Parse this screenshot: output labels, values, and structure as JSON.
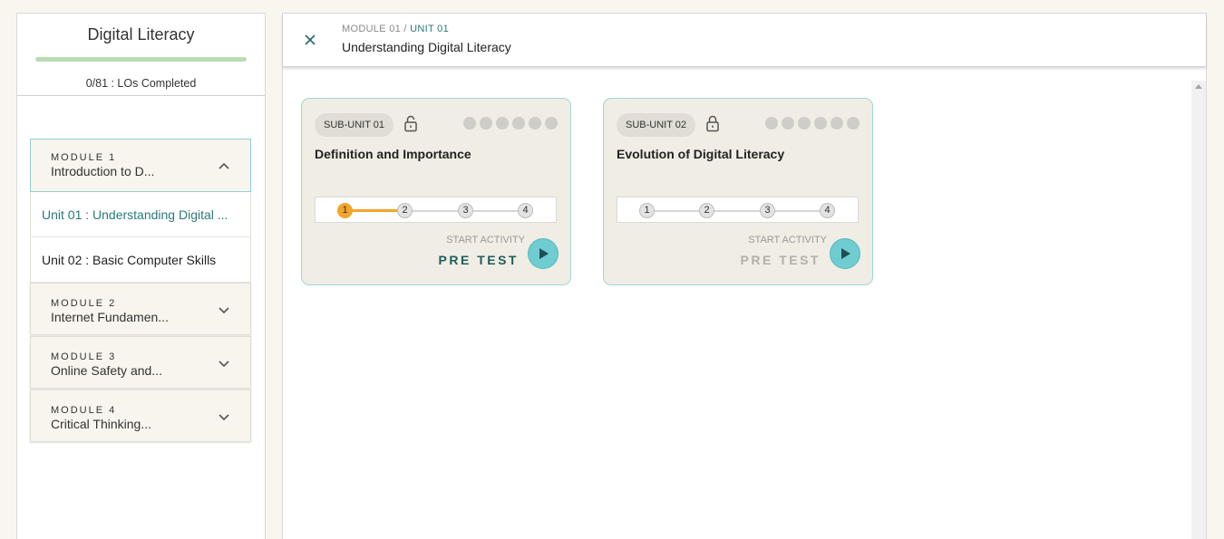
{
  "sidebar": {
    "title": "Digital Literacy",
    "progress_text": "0/81 : LOs Completed",
    "progress_fraction": 0,
    "modules": [
      {
        "number": "MODULE 1",
        "name": "Introduction to D...",
        "expanded": true,
        "units": [
          {
            "label": "Unit 01 : Understanding Digital ...",
            "active": true
          },
          {
            "label": "Unit 02 : Basic Computer Skills",
            "active": false
          }
        ]
      },
      {
        "number": "MODULE 2",
        "name": "Internet Fundamen...",
        "expanded": false
      },
      {
        "number": "MODULE 3",
        "name": "Online Safety and...",
        "expanded": false
      },
      {
        "number": "MODULE 4",
        "name": "Critical Thinking...",
        "expanded": false
      }
    ]
  },
  "header": {
    "breadcrumb_module": "MODULE 01",
    "breadcrumb_sep": "/",
    "breadcrumb_unit": "UNIT 01",
    "title": "Understanding Digital Literacy"
  },
  "cards": [
    {
      "subunit": "SUB-UNIT 01",
      "title": "Definition and Importance",
      "steps": [
        "1",
        "2",
        "3",
        "4"
      ],
      "current_step": 1,
      "start_label": "START ACTIVITY",
      "activity": "PRE TEST",
      "icon": "unlocked-lock-icon"
    },
    {
      "subunit": "SUB-UNIT 02",
      "title": "Evolution of Digital Literacy",
      "steps": [
        "1",
        "2",
        "3",
        "4"
      ],
      "current_step": 0,
      "start_label": "START ACTIVITY",
      "activity": "PRE TEST",
      "icon": "locked-lock-icon"
    }
  ],
  "colors": {
    "accent": "#2a7a78",
    "progress_orange": "#f3a52a",
    "play_teal": "#6fccd0",
    "card_bg": "#f0ede4"
  }
}
